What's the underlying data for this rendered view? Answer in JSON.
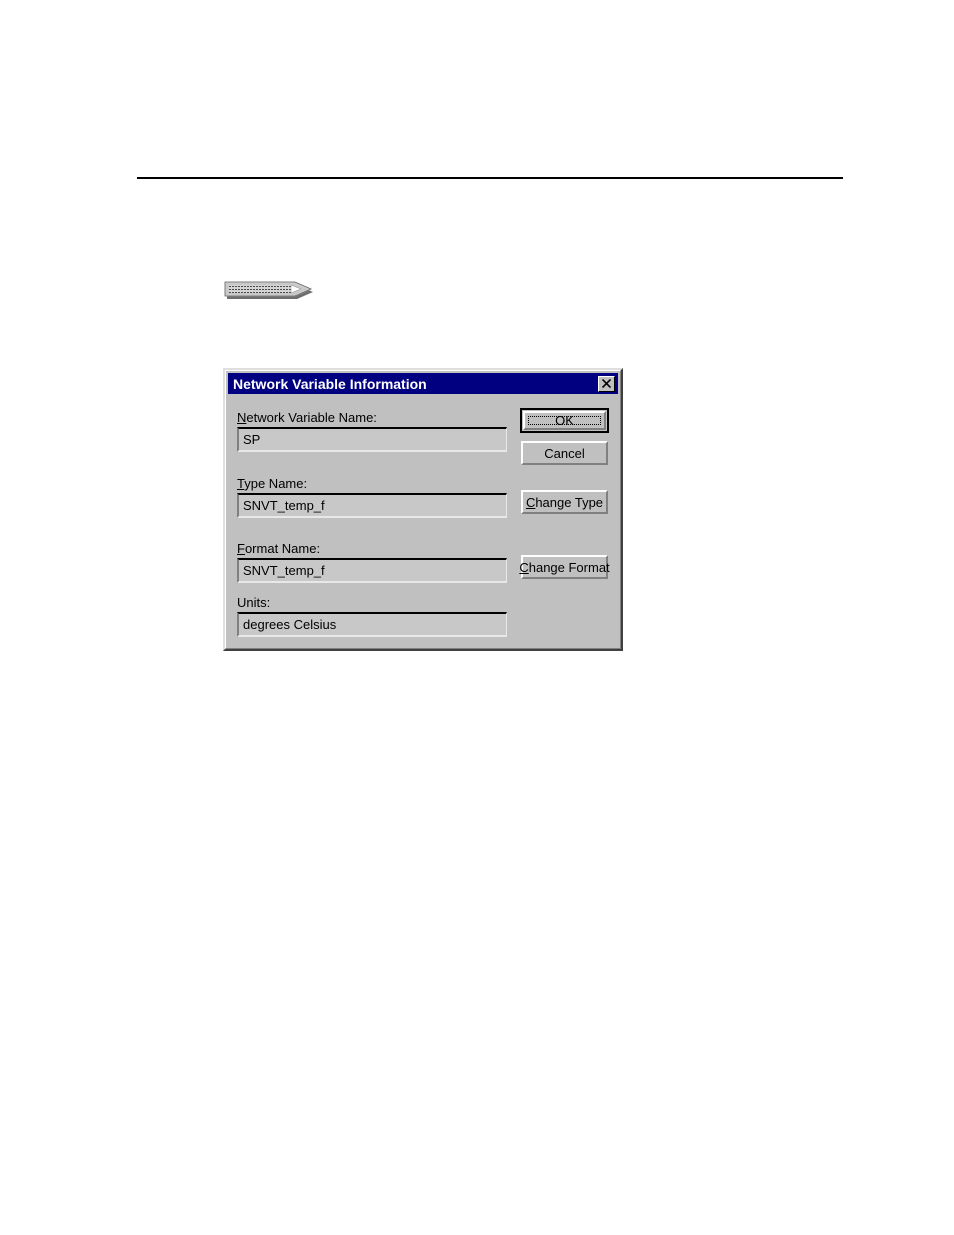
{
  "page": {
    "background_color": "#ffffff",
    "rule": {
      "name": "horizontal-rule",
      "color": "#000000"
    },
    "graphic": {
      "name": "arrow-banner-graphic",
      "alt": "hatched 3D arrow banner"
    }
  },
  "dialog": {
    "title": "Network Variable Information",
    "title_bar_color": "#000080",
    "title_text_color": "#ffffff",
    "face_color": "#c0c0c0",
    "close_button": {
      "label": "✕",
      "icon": "close-icon",
      "tooltip": "Close"
    },
    "fields": [
      {
        "id": "network-variable-name",
        "label_before": "",
        "label_accel": "N",
        "label_after": "etwork Variable Name:",
        "label_full": "Network Variable Name:",
        "value": "SP",
        "placeholder": "",
        "readonly": true
      },
      {
        "id": "type-name",
        "label_before": "",
        "label_accel": "T",
        "label_after": "ype Name:",
        "label_full": "Type Name:",
        "value": "SNVT_temp_f",
        "placeholder": "",
        "readonly": true
      },
      {
        "id": "format-name",
        "label_before": "",
        "label_accel": "F",
        "label_after": "ormat Name:",
        "label_full": "Format Name:",
        "value": "SNVT_temp_f",
        "placeholder": "",
        "readonly": true
      },
      {
        "id": "units",
        "label_before": "Units:",
        "label_accel": "",
        "label_after": "",
        "label_full": "Units:",
        "value": "degrees Celsius",
        "placeholder": "",
        "readonly": true
      }
    ],
    "buttons": [
      {
        "id": "ok",
        "label_before": "",
        "label_accel": "",
        "label_after": "OK",
        "label_full": "OK",
        "default": true,
        "focused": true
      },
      {
        "id": "cancel",
        "label_before": "",
        "label_accel": "",
        "label_after": "Cancel",
        "label_full": "Cancel",
        "default": false,
        "focused": false
      },
      {
        "id": "change-type",
        "label_before": "",
        "label_accel": "C",
        "label_after": "hange Type",
        "label_full": "Change Type",
        "default": false,
        "focused": false
      },
      {
        "id": "change-format",
        "label_before": "",
        "label_accel": "C",
        "label_after": "hange Format",
        "label_full": "Change Format",
        "default": false,
        "focused": false
      }
    ]
  }
}
